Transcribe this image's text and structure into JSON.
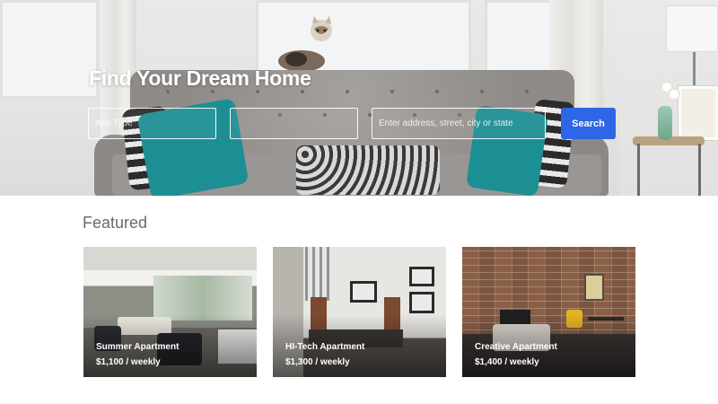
{
  "hero": {
    "title": "Find Your Dream Home",
    "search": {
      "type_placeholder": "Any Type",
      "middle_placeholder": "",
      "address_placeholder": "Enter address, street, city or state",
      "button_label": "Search"
    }
  },
  "featured": {
    "heading": "Featured",
    "cards": [
      {
        "title": "Summer Apartment",
        "price": "$1,100 / weekly"
      },
      {
        "title": "HI-Tech Apartment",
        "price": "$1,300 / weekly"
      },
      {
        "title": "Creative Apartment",
        "price": "$1,400 / weekly"
      }
    ]
  },
  "colors": {
    "accent": "#2d66e6",
    "hero_text": "#ffffff",
    "heading_text": "#6a6a6a"
  }
}
